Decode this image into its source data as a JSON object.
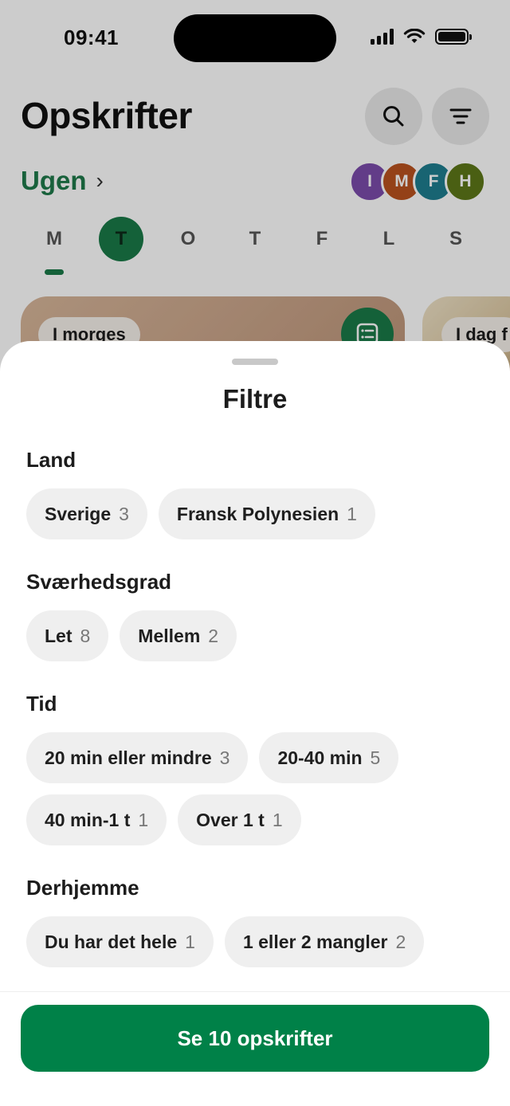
{
  "status_bar": {
    "time": "09:41"
  },
  "header": {
    "title": "Opskrifter",
    "search_icon": "search-icon",
    "filter_icon": "filter-icon"
  },
  "week": {
    "label": "Ugen",
    "chevron": "›",
    "members": [
      {
        "initial": "I",
        "color": "#7b4bab"
      },
      {
        "initial": "M",
        "color": "#b9521f"
      },
      {
        "initial": "F",
        "color": "#1f7e8f"
      },
      {
        "initial": "H",
        "color": "#5d7718"
      }
    ],
    "days": [
      "M",
      "T",
      "O",
      "T",
      "F",
      "L",
      "S"
    ],
    "selected_day_index": 1
  },
  "cards": [
    {
      "label": "I morges"
    },
    {
      "label": "I dag f"
    }
  ],
  "sheet": {
    "title": "Filtre",
    "sections": [
      {
        "title": "Land",
        "chips": [
          {
            "label": "Sverige",
            "count": "3"
          },
          {
            "label": "Fransk Polynesien",
            "count": "1"
          }
        ]
      },
      {
        "title": "Sværhedsgrad",
        "chips": [
          {
            "label": "Let",
            "count": "8"
          },
          {
            "label": "Mellem",
            "count": "2"
          }
        ]
      },
      {
        "title": "Tid",
        "chips": [
          {
            "label": "20 min eller mindre",
            "count": "3"
          },
          {
            "label": "20-40 min",
            "count": "5"
          },
          {
            "label": "40 min-1 t",
            "count": "1"
          },
          {
            "label": "Over 1 t",
            "count": "1"
          }
        ]
      },
      {
        "title": "Derhjemme",
        "chips": [
          {
            "label": "Du har det hele",
            "count": "1"
          },
          {
            "label": "1 eller 2 mangler",
            "count": "2"
          }
        ]
      }
    ],
    "cta_label": "Se 10 opskrifter"
  },
  "colors": {
    "accent_green": "#008148",
    "week_green": "#1f7a4a",
    "chip_bg": "#efefef"
  }
}
